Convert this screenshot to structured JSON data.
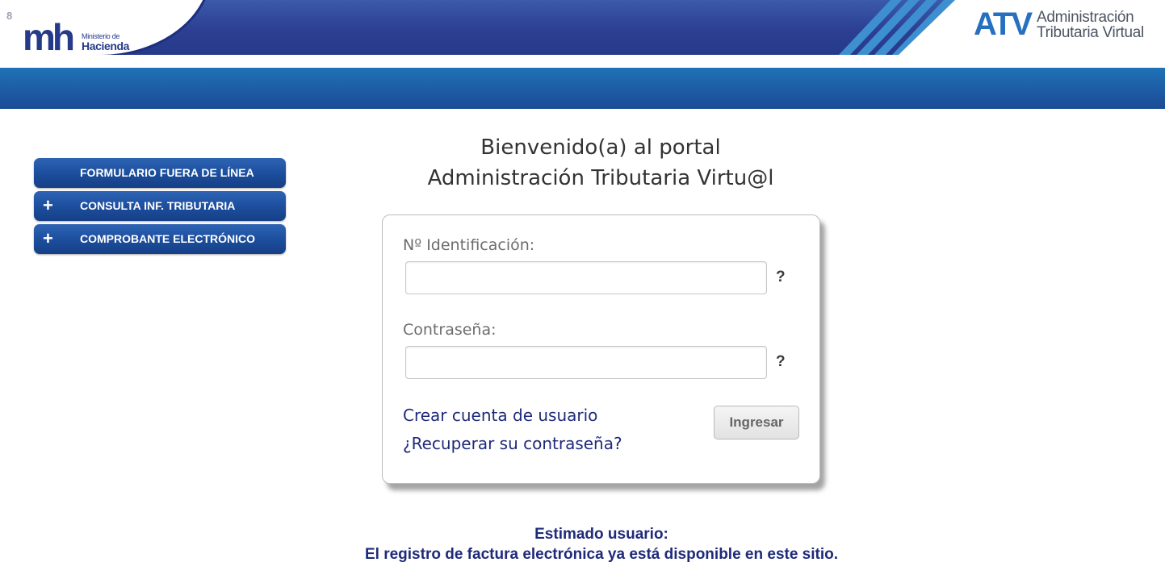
{
  "header": {
    "corner_number": "8",
    "ministry_logo_mark": "mh",
    "ministry_line1": "Ministerio de",
    "ministry_line2": "Hacienda",
    "atv_mark": "ATV",
    "atv_line1": "Administración",
    "atv_line2": "Tributaria Virtual"
  },
  "sidebar": {
    "items": [
      {
        "label": "FORMULARIO FUERA DE LÍNEA",
        "expandable": false
      },
      {
        "label": "CONSULTA INF. TRIBUTARIA",
        "expandable": true,
        "icon": "+"
      },
      {
        "label": "COMPROBANTE ELECTRÓNICO",
        "expandable": true,
        "icon": "+"
      }
    ]
  },
  "welcome": {
    "line1": "Bienvenido(a) al portal",
    "line2": "Administración Tributaria Virtu@l"
  },
  "login": {
    "id_label": "Nº Identificación:",
    "id_value": "",
    "id_help": "?",
    "password_label": "Contraseña:",
    "password_value": "",
    "password_help": "?",
    "create_account": "Crear cuenta de usuario",
    "recover_password": "¿Recuperar su contraseña?",
    "submit": "Ingresar"
  },
  "notice": {
    "line1": "Estimado usuario:",
    "line2": "El registro de factura electrónica ya está disponible en este sitio."
  },
  "colors": {
    "header_blue": "#2c3f93",
    "subbar_blue": "#1d5aa3",
    "link_navy": "#1f2a7a",
    "atv_blue": "#2670bf"
  }
}
